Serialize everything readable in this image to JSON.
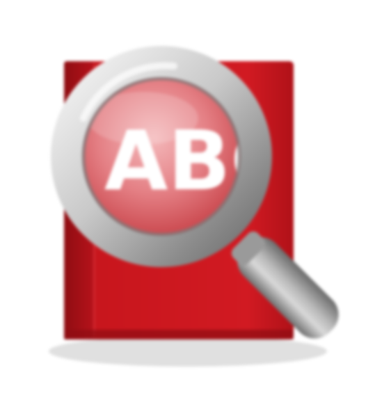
{
  "icon": {
    "name": "spell-check-icon",
    "lens_text": "ABC"
  },
  "colors": {
    "background": "#ffffff",
    "book_red": "#c8161d",
    "book_red_dark": "#8f0d12",
    "lens_pink": "#e98b8f",
    "metal_light": "#f2f2f2",
    "metal_mid": "#bdbdbd",
    "metal_dark": "#7a7a7a"
  }
}
